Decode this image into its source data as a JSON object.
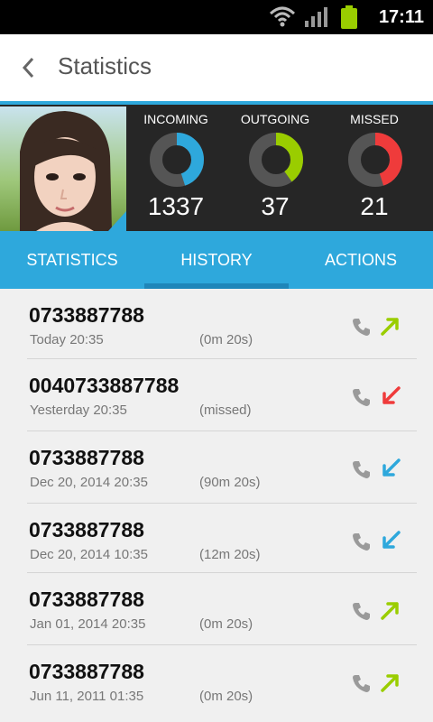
{
  "status": {
    "time": "17:11"
  },
  "appbar": {
    "title": "Statistics"
  },
  "stats": [
    {
      "label": "INCOMING",
      "count": "1337",
      "color": "#2ea8dc",
      "fraction": 0.45
    },
    {
      "label": "OUTGOING",
      "count": "37",
      "color": "#9acd00",
      "fraction": 0.4
    },
    {
      "label": "MISSED",
      "count": "21",
      "color": "#ef3b3b",
      "fraction": 0.45
    }
  ],
  "tabs": [
    {
      "label": "STATISTICS"
    },
    {
      "label": "HISTORY",
      "selected": true
    },
    {
      "label": "ACTIONS"
    }
  ],
  "calls": [
    {
      "number": "0733887788",
      "date": "Today 20:35",
      "duration": "(0m 20s)",
      "type": "outgoing"
    },
    {
      "number": "0040733887788",
      "date": "Yesterday 20:35",
      "duration": "(missed)",
      "type": "missed"
    },
    {
      "number": "0733887788",
      "date": "Dec 20, 2014 20:35",
      "duration": "(90m 20s)",
      "type": "incoming"
    },
    {
      "number": "0733887788",
      "date": "Dec 20, 2014 10:35",
      "duration": "(12m 20s)",
      "type": "incoming"
    },
    {
      "number": "0733887788",
      "date": "Jan 01, 2014 20:35",
      "duration": "(0m 20s)",
      "type": "outgoing"
    },
    {
      "number": "0733887788",
      "date": "Jun 11, 2011 01:35",
      "duration": "(0m 20s)",
      "type": "outgoing"
    }
  ],
  "colors": {
    "accent": "#2ea8dc",
    "outgoing": "#9acd00",
    "missed": "#ef3b3b",
    "incoming": "#2ea8dc"
  }
}
